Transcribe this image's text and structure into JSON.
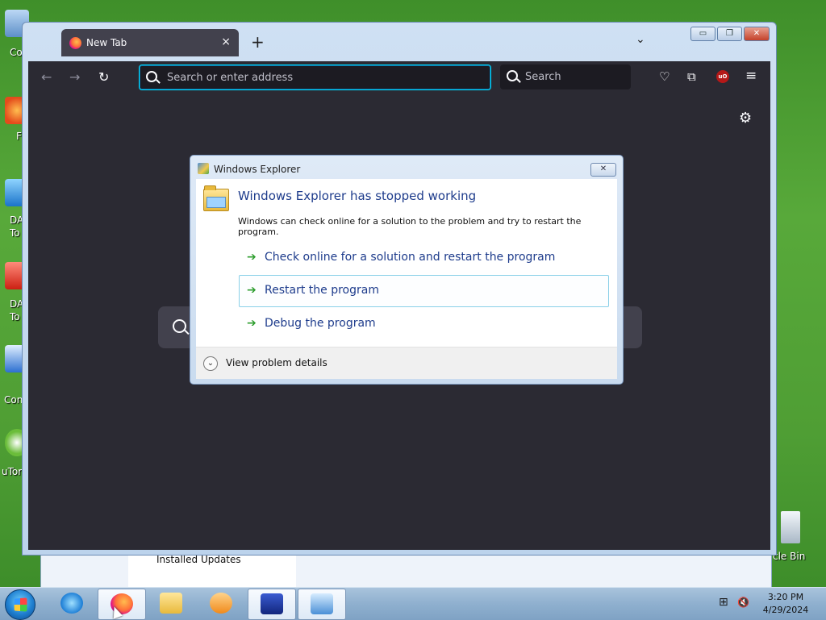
{
  "desktop": {
    "icon_labels": [
      "Co",
      "F",
      "DA",
      "To",
      "DA",
      "To",
      "Con",
      "uTor"
    ],
    "recycle_bin_label": "cle Bin"
  },
  "background_window": {
    "item_label": "Installed Updates"
  },
  "browser": {
    "tab": {
      "title": "New Tab",
      "close_glyph": "×"
    },
    "new_tab_glyph": "+",
    "tab_list_glyph": "⌄",
    "window_buttons": {
      "minimize": "▭",
      "maximize": "❐",
      "close": "✕"
    },
    "nav": {
      "back": "←",
      "forward": "→",
      "reload": "↻"
    },
    "urlbar": {
      "placeholder": "Search or enter address",
      "value": ""
    },
    "searchbox": {
      "placeholder": "Search"
    },
    "toolbar_icons": {
      "pocket": "♡",
      "extensions": "⧉",
      "ublock": "uO",
      "menu": "≡"
    },
    "settings_glyph": "⚙"
  },
  "dialog": {
    "title": "Windows Explorer",
    "close_glyph": "✕",
    "headline": "Windows Explorer has stopped working",
    "description": "Windows can check online for a solution to the problem and try to restart the program.",
    "options": [
      {
        "label": "Check online for a solution and restart the program",
        "highlighted": false
      },
      {
        "label": "Restart the program",
        "highlighted": true
      },
      {
        "label": "Debug the program",
        "highlighted": false
      }
    ],
    "arrow_glyph": "➔",
    "details_label": "View problem details",
    "details_glyph": "⌄"
  },
  "taskbar": {
    "clock": {
      "time": "3:20 PM",
      "date": "4/29/2024"
    },
    "tray_icons": {
      "network": "⊞",
      "volume": "🔇"
    }
  },
  "colors": {
    "desktop_green": "#4f9e34",
    "firefox_dark": "#2b2a33",
    "accent_focus": "#00ddff",
    "dialog_headline": "#1e3c8c",
    "option_arrow": "#2f9e2f"
  }
}
